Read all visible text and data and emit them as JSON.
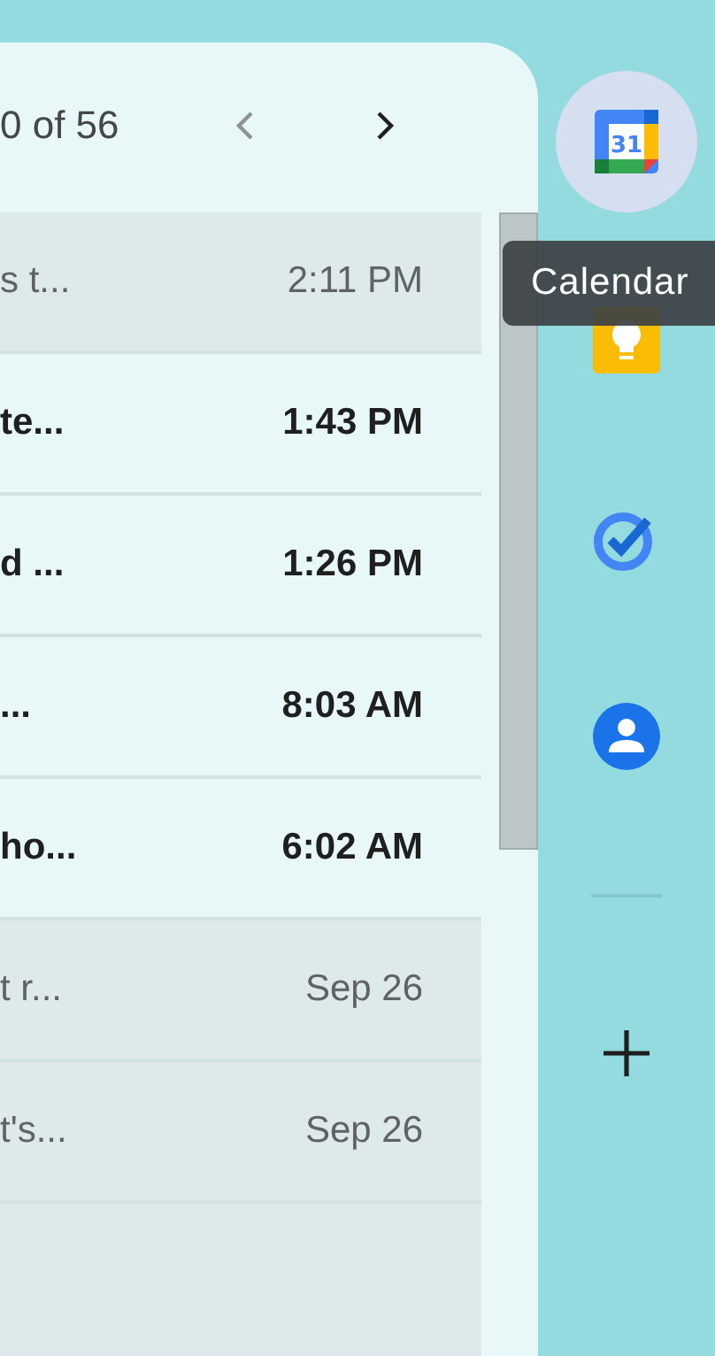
{
  "pagination": {
    "range": "0 of 56",
    "previous": {
      "disabled": true
    },
    "next": {
      "disabled": false
    }
  },
  "messages": [
    {
      "snippet": "s t...",
      "time": "2:11 PM",
      "unread": false
    },
    {
      "snippet": "te...",
      "time": "1:43 PM",
      "unread": true
    },
    {
      "snippet": "d ...",
      "time": "1:26 PM",
      "unread": true
    },
    {
      "snippet": "...",
      "time": "8:03 AM",
      "unread": true
    },
    {
      "snippet": "ho...",
      "time": "6:02 AM",
      "unread": true
    },
    {
      "snippet": "t r...",
      "time": "Sep 26",
      "unread": false
    },
    {
      "snippet": "t's...",
      "time": "Sep 26",
      "unread": false
    }
  ],
  "side_panel": {
    "apps": [
      {
        "kind": "calendar",
        "selected": true,
        "day": "31"
      },
      {
        "kind": "keep",
        "selected": false
      },
      {
        "kind": "tasks",
        "selected": false
      },
      {
        "kind": "contacts",
        "selected": false
      }
    ]
  },
  "tooltip": "Calendar"
}
